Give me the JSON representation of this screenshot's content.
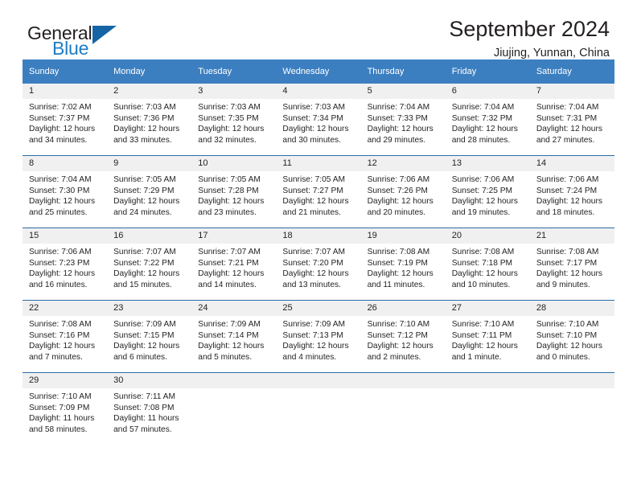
{
  "brand": {
    "word_one": "General",
    "word_two": "Blue",
    "triangle_icon": "triangle-icon",
    "accent_color": "#1d7cc4",
    "triangle_color": "#1565a6"
  },
  "header": {
    "title": "September 2024",
    "subtitle": "Jiujing, Yunnan, China"
  },
  "calendar": {
    "header_bg": "#3c7fc0",
    "daynum_bg": "#f0f0f0",
    "rule_color": "#2b6ca8",
    "weekday_headers": [
      "Sunday",
      "Monday",
      "Tuesday",
      "Wednesday",
      "Thursday",
      "Friday",
      "Saturday"
    ],
    "weeks": [
      [
        {
          "day": "1",
          "sunrise": "Sunrise: 7:02 AM",
          "sunset": "Sunset: 7:37 PM",
          "daylight_line1": "Daylight: 12 hours",
          "daylight_line2": "and 34 minutes."
        },
        {
          "day": "2",
          "sunrise": "Sunrise: 7:03 AM",
          "sunset": "Sunset: 7:36 PM",
          "daylight_line1": "Daylight: 12 hours",
          "daylight_line2": "and 33 minutes."
        },
        {
          "day": "3",
          "sunrise": "Sunrise: 7:03 AM",
          "sunset": "Sunset: 7:35 PM",
          "daylight_line1": "Daylight: 12 hours",
          "daylight_line2": "and 32 minutes."
        },
        {
          "day": "4",
          "sunrise": "Sunrise: 7:03 AM",
          "sunset": "Sunset: 7:34 PM",
          "daylight_line1": "Daylight: 12 hours",
          "daylight_line2": "and 30 minutes."
        },
        {
          "day": "5",
          "sunrise": "Sunrise: 7:04 AM",
          "sunset": "Sunset: 7:33 PM",
          "daylight_line1": "Daylight: 12 hours",
          "daylight_line2": "and 29 minutes."
        },
        {
          "day": "6",
          "sunrise": "Sunrise: 7:04 AM",
          "sunset": "Sunset: 7:32 PM",
          "daylight_line1": "Daylight: 12 hours",
          "daylight_line2": "and 28 minutes."
        },
        {
          "day": "7",
          "sunrise": "Sunrise: 7:04 AM",
          "sunset": "Sunset: 7:31 PM",
          "daylight_line1": "Daylight: 12 hours",
          "daylight_line2": "and 27 minutes."
        }
      ],
      [
        {
          "day": "8",
          "sunrise": "Sunrise: 7:04 AM",
          "sunset": "Sunset: 7:30 PM",
          "daylight_line1": "Daylight: 12 hours",
          "daylight_line2": "and 25 minutes."
        },
        {
          "day": "9",
          "sunrise": "Sunrise: 7:05 AM",
          "sunset": "Sunset: 7:29 PM",
          "daylight_line1": "Daylight: 12 hours",
          "daylight_line2": "and 24 minutes."
        },
        {
          "day": "10",
          "sunrise": "Sunrise: 7:05 AM",
          "sunset": "Sunset: 7:28 PM",
          "daylight_line1": "Daylight: 12 hours",
          "daylight_line2": "and 23 minutes."
        },
        {
          "day": "11",
          "sunrise": "Sunrise: 7:05 AM",
          "sunset": "Sunset: 7:27 PM",
          "daylight_line1": "Daylight: 12 hours",
          "daylight_line2": "and 21 minutes."
        },
        {
          "day": "12",
          "sunrise": "Sunrise: 7:06 AM",
          "sunset": "Sunset: 7:26 PM",
          "daylight_line1": "Daylight: 12 hours",
          "daylight_line2": "and 20 minutes."
        },
        {
          "day": "13",
          "sunrise": "Sunrise: 7:06 AM",
          "sunset": "Sunset: 7:25 PM",
          "daylight_line1": "Daylight: 12 hours",
          "daylight_line2": "and 19 minutes."
        },
        {
          "day": "14",
          "sunrise": "Sunrise: 7:06 AM",
          "sunset": "Sunset: 7:24 PM",
          "daylight_line1": "Daylight: 12 hours",
          "daylight_line2": "and 18 minutes."
        }
      ],
      [
        {
          "day": "15",
          "sunrise": "Sunrise: 7:06 AM",
          "sunset": "Sunset: 7:23 PM",
          "daylight_line1": "Daylight: 12 hours",
          "daylight_line2": "and 16 minutes."
        },
        {
          "day": "16",
          "sunrise": "Sunrise: 7:07 AM",
          "sunset": "Sunset: 7:22 PM",
          "daylight_line1": "Daylight: 12 hours",
          "daylight_line2": "and 15 minutes."
        },
        {
          "day": "17",
          "sunrise": "Sunrise: 7:07 AM",
          "sunset": "Sunset: 7:21 PM",
          "daylight_line1": "Daylight: 12 hours",
          "daylight_line2": "and 14 minutes."
        },
        {
          "day": "18",
          "sunrise": "Sunrise: 7:07 AM",
          "sunset": "Sunset: 7:20 PM",
          "daylight_line1": "Daylight: 12 hours",
          "daylight_line2": "and 13 minutes."
        },
        {
          "day": "19",
          "sunrise": "Sunrise: 7:08 AM",
          "sunset": "Sunset: 7:19 PM",
          "daylight_line1": "Daylight: 12 hours",
          "daylight_line2": "and 11 minutes."
        },
        {
          "day": "20",
          "sunrise": "Sunrise: 7:08 AM",
          "sunset": "Sunset: 7:18 PM",
          "daylight_line1": "Daylight: 12 hours",
          "daylight_line2": "and 10 minutes."
        },
        {
          "day": "21",
          "sunrise": "Sunrise: 7:08 AM",
          "sunset": "Sunset: 7:17 PM",
          "daylight_line1": "Daylight: 12 hours",
          "daylight_line2": "and 9 minutes."
        }
      ],
      [
        {
          "day": "22",
          "sunrise": "Sunrise: 7:08 AM",
          "sunset": "Sunset: 7:16 PM",
          "daylight_line1": "Daylight: 12 hours",
          "daylight_line2": "and 7 minutes."
        },
        {
          "day": "23",
          "sunrise": "Sunrise: 7:09 AM",
          "sunset": "Sunset: 7:15 PM",
          "daylight_line1": "Daylight: 12 hours",
          "daylight_line2": "and 6 minutes."
        },
        {
          "day": "24",
          "sunrise": "Sunrise: 7:09 AM",
          "sunset": "Sunset: 7:14 PM",
          "daylight_line1": "Daylight: 12 hours",
          "daylight_line2": "and 5 minutes."
        },
        {
          "day": "25",
          "sunrise": "Sunrise: 7:09 AM",
          "sunset": "Sunset: 7:13 PM",
          "daylight_line1": "Daylight: 12 hours",
          "daylight_line2": "and 4 minutes."
        },
        {
          "day": "26",
          "sunrise": "Sunrise: 7:10 AM",
          "sunset": "Sunset: 7:12 PM",
          "daylight_line1": "Daylight: 12 hours",
          "daylight_line2": "and 2 minutes."
        },
        {
          "day": "27",
          "sunrise": "Sunrise: 7:10 AM",
          "sunset": "Sunset: 7:11 PM",
          "daylight_line1": "Daylight: 12 hours",
          "daylight_line2": "and 1 minute."
        },
        {
          "day": "28",
          "sunrise": "Sunrise: 7:10 AM",
          "sunset": "Sunset: 7:10 PM",
          "daylight_line1": "Daylight: 12 hours",
          "daylight_line2": "and 0 minutes."
        }
      ],
      [
        {
          "day": "29",
          "sunrise": "Sunrise: 7:10 AM",
          "sunset": "Sunset: 7:09 PM",
          "daylight_line1": "Daylight: 11 hours",
          "daylight_line2": "and 58 minutes."
        },
        {
          "day": "30",
          "sunrise": "Sunrise: 7:11 AM",
          "sunset": "Sunset: 7:08 PM",
          "daylight_line1": "Daylight: 11 hours",
          "daylight_line2": "and 57 minutes."
        },
        {
          "day": "",
          "sunrise": "",
          "sunset": "",
          "daylight_line1": "",
          "daylight_line2": ""
        },
        {
          "day": "",
          "sunrise": "",
          "sunset": "",
          "daylight_line1": "",
          "daylight_line2": ""
        },
        {
          "day": "",
          "sunrise": "",
          "sunset": "",
          "daylight_line1": "",
          "daylight_line2": ""
        },
        {
          "day": "",
          "sunrise": "",
          "sunset": "",
          "daylight_line1": "",
          "daylight_line2": ""
        },
        {
          "day": "",
          "sunrise": "",
          "sunset": "",
          "daylight_line1": "",
          "daylight_line2": ""
        }
      ]
    ]
  }
}
